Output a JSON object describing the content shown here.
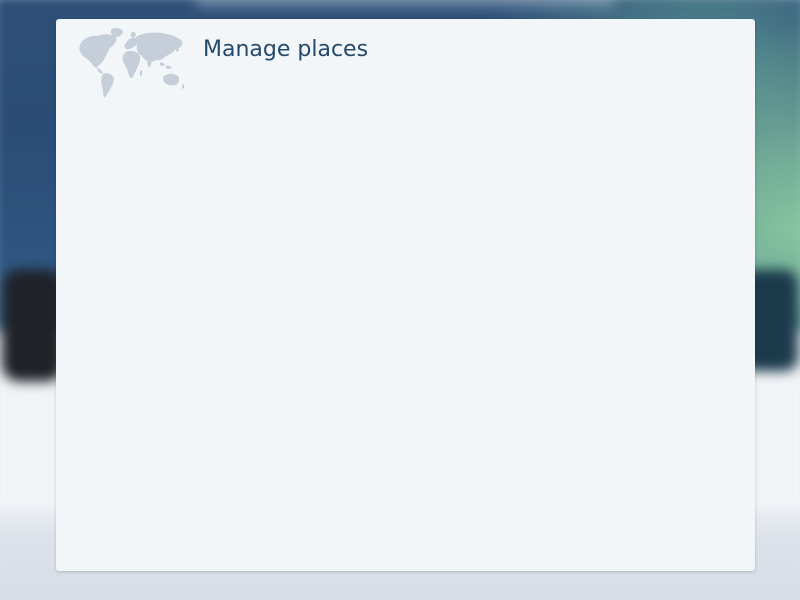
{
  "dialog": {
    "title": "Manage places",
    "icon": "world-map-icon"
  },
  "colors": {
    "title_text": "#23496b",
    "panel_background": "#f3f6f9",
    "map_icon": "#c5ced9",
    "backdrop_blue": "#2d5580",
    "backdrop_green": "#86c6a0"
  }
}
